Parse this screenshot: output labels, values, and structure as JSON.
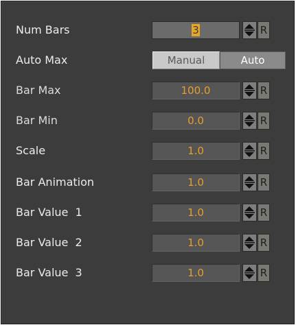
{
  "rows": [
    {
      "label": "Num Bars",
      "value": "3",
      "type": "field"
    },
    {
      "label": "Auto Max",
      "type": "toggle",
      "options": [
        "Manual",
        "Auto"
      ],
      "selected": "Manual"
    },
    {
      "label": "Bar Max",
      "value": "100.0",
      "type": "field"
    },
    {
      "label": "Bar Min",
      "value": "0.0",
      "type": "field"
    },
    {
      "label": "Scale",
      "value": "1.0",
      "type": "field"
    },
    {
      "label": "Bar Animation",
      "value": "1.0",
      "type": "field"
    },
    {
      "label": "Bar Value  1",
      "value": "1.0",
      "type": "field"
    },
    {
      "label": "Bar Value  2",
      "value": "1.0",
      "type": "field"
    },
    {
      "label": "Bar Value  3",
      "value": "1.0",
      "type": "field"
    }
  ],
  "reset_label": "R",
  "spinner_icon": "spinner-arrows-icon",
  "colors": {
    "panel_bg": "#3c3c3c",
    "value_text": "#e6a02a",
    "label_text": "#ececec"
  }
}
